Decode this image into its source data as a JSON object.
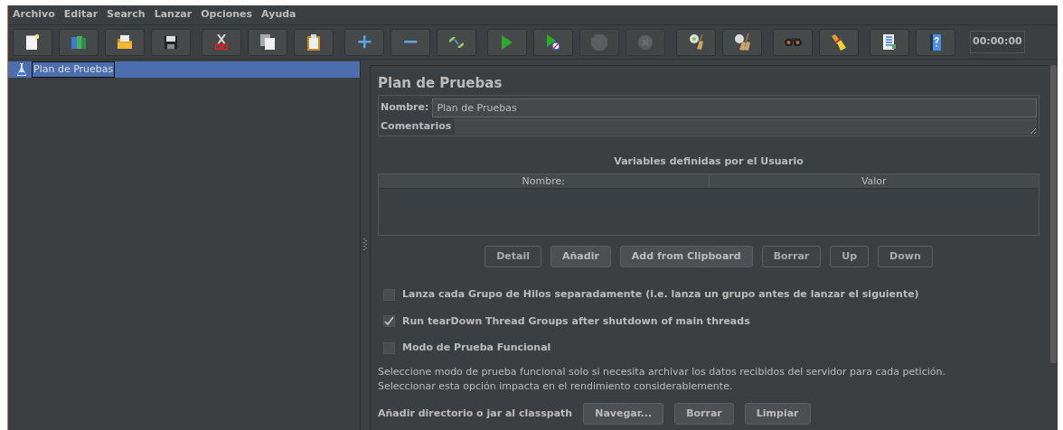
{
  "menu": [
    {
      "label": "Archivo"
    },
    {
      "label": "Editar"
    },
    {
      "label": "Search"
    },
    {
      "label": "Lanzar"
    },
    {
      "label": "Opciones"
    },
    {
      "label": "Ayuda"
    }
  ],
  "toolbar": [
    [
      {
        "kind": "new",
        "disabled": false
      },
      {
        "kind": "templates",
        "disabled": false
      },
      {
        "kind": "open",
        "disabled": false
      },
      {
        "kind": "save",
        "disabled": false
      }
    ],
    [
      {
        "kind": "cut",
        "disabled": false
      },
      {
        "kind": "copy",
        "disabled": false
      },
      {
        "kind": "paste",
        "disabled": false
      }
    ],
    [
      {
        "kind": "expand",
        "disabled": false
      },
      {
        "kind": "collapse",
        "disabled": false
      },
      {
        "kind": "toggle",
        "disabled": false
      }
    ],
    [
      {
        "kind": "start",
        "disabled": false
      },
      {
        "kind": "start-no-pause",
        "disabled": false
      },
      {
        "kind": "stop",
        "disabled": true
      },
      {
        "kind": "shutdown",
        "disabled": true
      }
    ],
    [
      {
        "kind": "clear",
        "disabled": false
      },
      {
        "kind": "clear-all",
        "disabled": false
      }
    ],
    [
      {
        "kind": "search",
        "disabled": false
      },
      {
        "kind": "reset-search",
        "disabled": false
      }
    ],
    [
      {
        "kind": "functions",
        "disabled": false
      },
      {
        "kind": "help",
        "disabled": false
      }
    ]
  ],
  "timer": "00:00:00",
  "tree": [
    {
      "label": "Plan de Pruebas",
      "selected": true
    }
  ],
  "panel": {
    "title": "Plan de Pruebas",
    "name_label": "Nombre:",
    "name_value": "Plan de Pruebas",
    "comments_label": "Comentarios",
    "table": {
      "title": "Variables definidas por el Usuario",
      "columns": [
        "Nombre:",
        "Valor"
      ]
    },
    "table_buttons": [
      {
        "label": "Detail",
        "disabled": true
      },
      {
        "label": "Añadir",
        "disabled": false
      },
      {
        "label": "Add from Clipboard",
        "disabled": false
      },
      {
        "label": "Borrar",
        "disabled": true
      },
      {
        "label": "Up",
        "disabled": true
      },
      {
        "label": "Down",
        "disabled": true
      }
    ],
    "options": [
      {
        "label": "Lanza cada Grupo de Hilos separadamente (i.e. lanza un grupo antes de lanzar el siguiente)",
        "checked": false
      },
      {
        "label": "Run tearDown Thread Groups after shutdown of main threads",
        "checked": true
      },
      {
        "label": "Modo de Prueba Funcional",
        "checked": false
      }
    ],
    "note": [
      "Seleccione modo de prueba funcional solo si necesita archivar los datos recibidos del servidor para cada petición.",
      "Seleccionar esta opción impacta en el rendimiento considerablemente."
    ],
    "classpath_label": "Añadir directorio o jar al classpath",
    "classpath_buttons": [
      {
        "label": "Navegar...",
        "disabled": false
      },
      {
        "label": "Borrar",
        "disabled": false
      },
      {
        "label": "Limpiar",
        "disabled": false
      }
    ]
  }
}
